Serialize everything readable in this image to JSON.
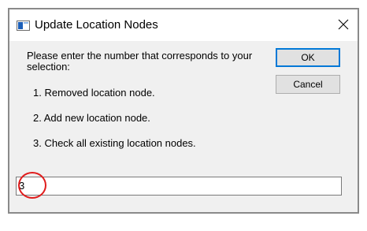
{
  "window": {
    "title": "Update Location Nodes"
  },
  "dialog": {
    "prompt": "Please enter the number that corresponds to your selection:",
    "options": [
      "1. Removed location node.",
      "2. Add new location node.",
      "3. Check all existing location nodes."
    ],
    "ok_label": "OK",
    "cancel_label": "Cancel",
    "input_value": "3"
  },
  "icons": {
    "app": "app-window-icon",
    "close": "close-icon"
  },
  "colors": {
    "annotation_circle": "#e01c1c",
    "default_button_border": "#0078d7"
  }
}
